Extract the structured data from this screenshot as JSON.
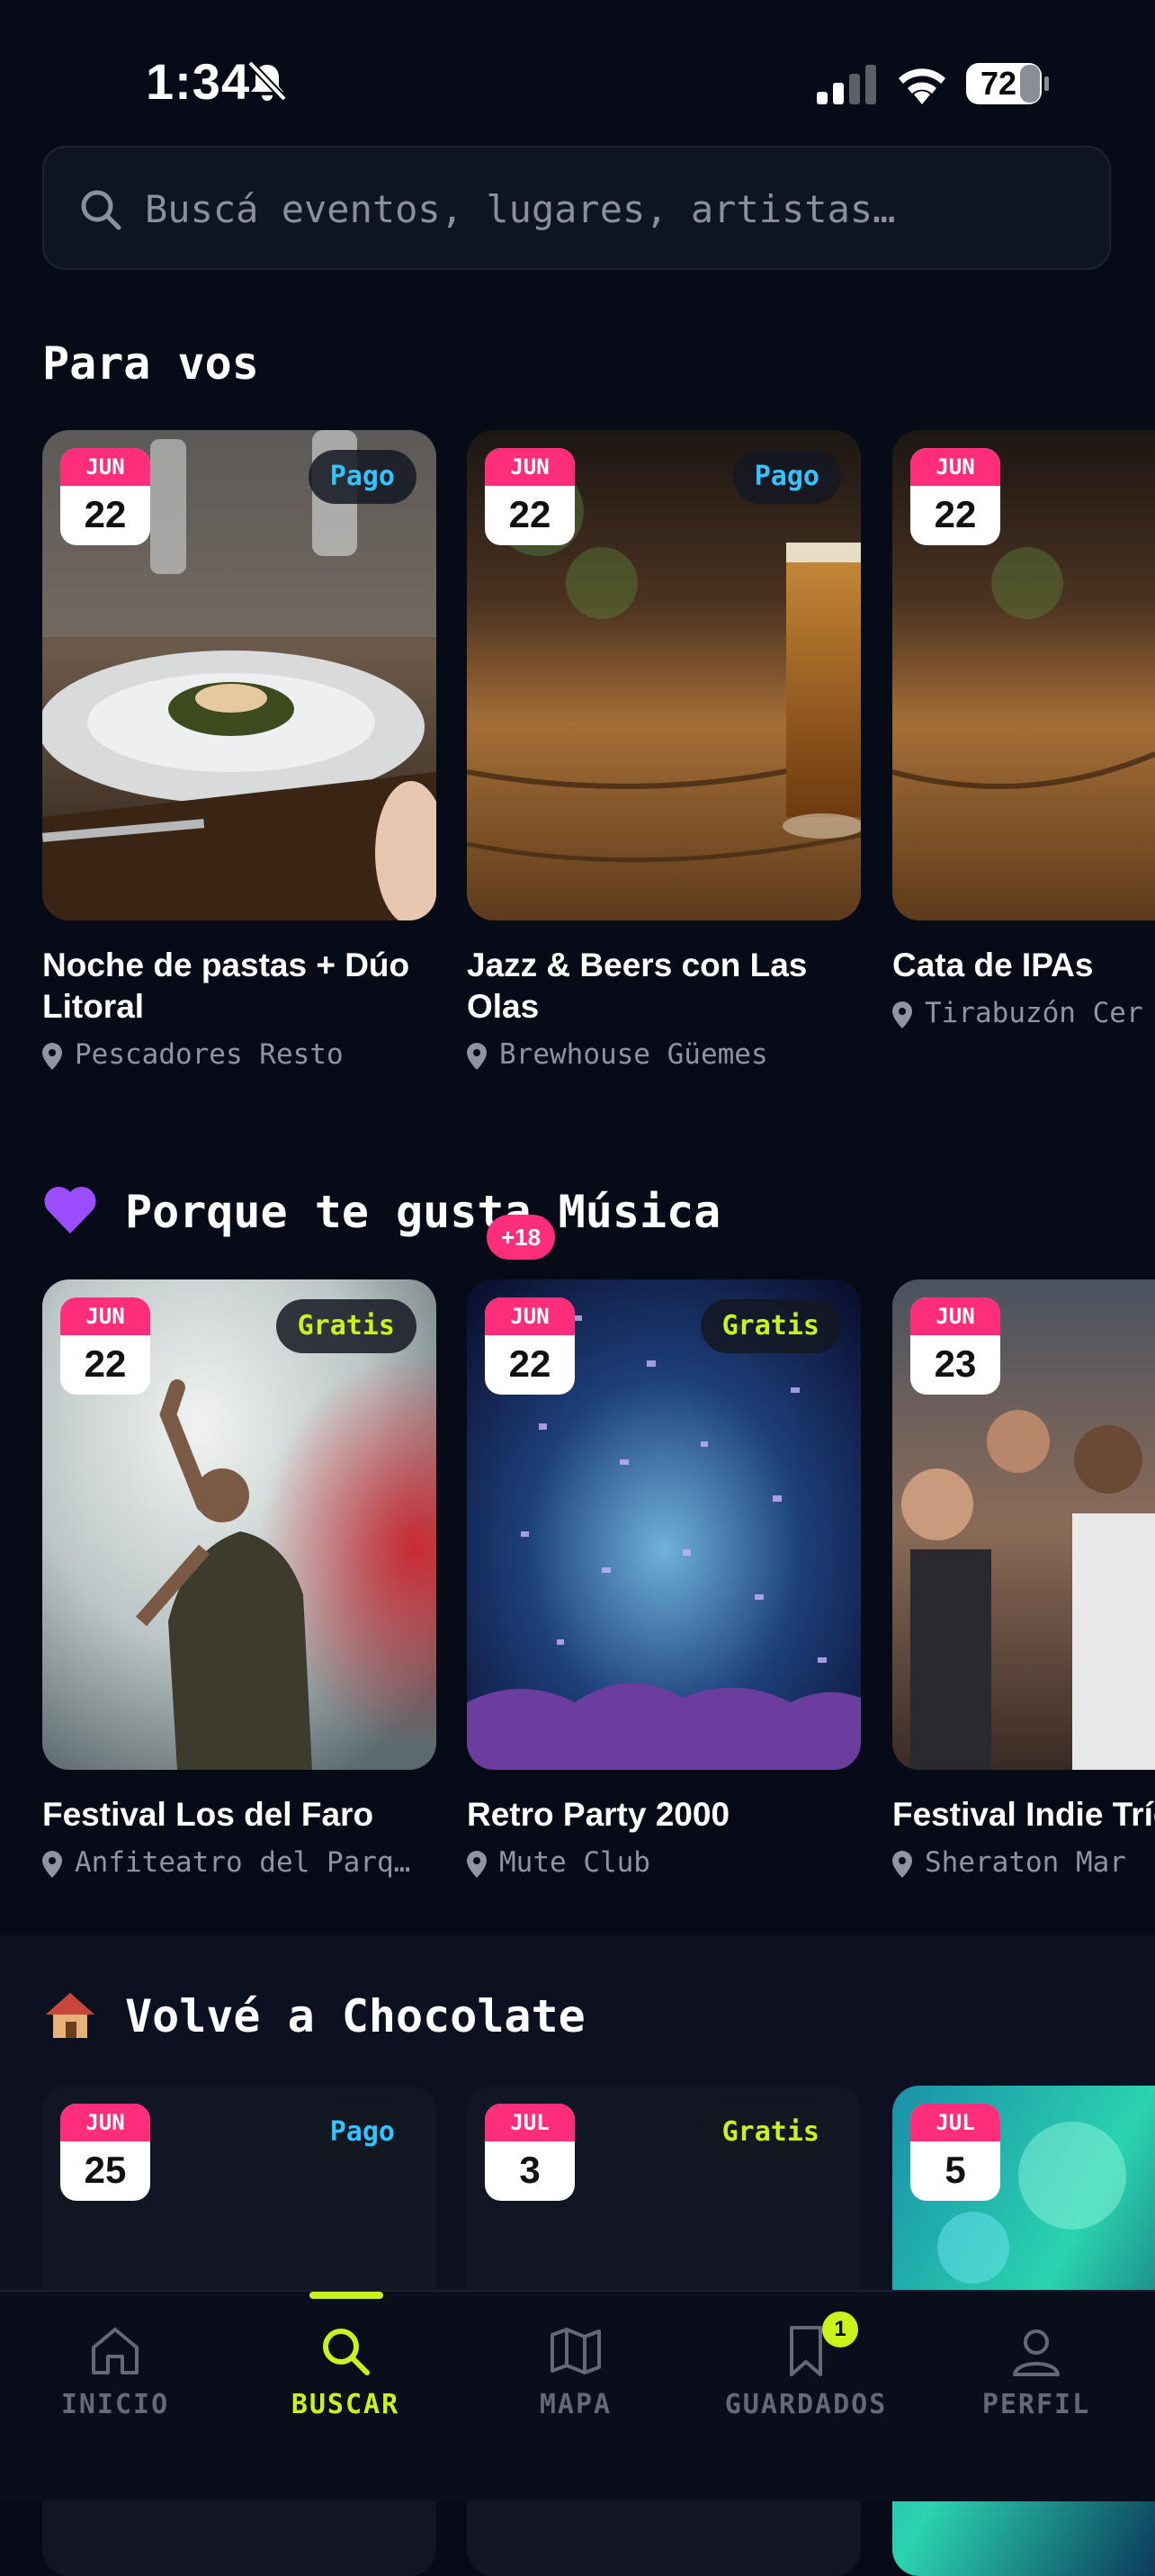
{
  "status_bar": {
    "time": "1:34",
    "battery": "72"
  },
  "search": {
    "placeholder": "Buscá eventos, lugares, artistas…"
  },
  "sections": [
    {
      "title": "Para vos",
      "cards": [
        {
          "month": "JUN",
          "day": "22",
          "price": "Pago",
          "title": "Noche de pastas + Dúo Litoral",
          "venue": "Pescadores Resto"
        },
        {
          "month": "JUN",
          "day": "22",
          "price": "Pago",
          "title": "Jazz & Beers con Las Olas",
          "venue": "Brewhouse Güemes"
        },
        {
          "month": "JUN",
          "day": "22",
          "price": "",
          "title": "Cata de IPAs",
          "venue": "Tirabuzón Cer"
        }
      ]
    },
    {
      "title": "Porque te gusta Música",
      "emoji": "purple-heart-icon",
      "cards": [
        {
          "month": "JUN",
          "day": "22",
          "price": "Gratis",
          "title": "Festival Los del Faro",
          "venue": "Anfiteatro del Parq…"
        },
        {
          "month": "JUN",
          "day": "22",
          "price": "Gratis",
          "age": "+18",
          "title": "Retro Party 2000",
          "venue": "Mute Club"
        },
        {
          "month": "JUN",
          "day": "23",
          "price": "",
          "title": "Festival Indie Trío",
          "venue": "Sheraton Mar"
        }
      ]
    },
    {
      "title": "Volvé a Chocolate",
      "emoji": "house-icon",
      "cards": [
        {
          "month": "JUN",
          "day": "25",
          "price": "Pago"
        },
        {
          "month": "JUL",
          "day": "3",
          "price": "Gratis"
        },
        {
          "month": "JUL",
          "day": "5",
          "price": ""
        }
      ]
    }
  ],
  "bottom_nav": [
    {
      "label": "INICIO",
      "icon": "home-icon"
    },
    {
      "label": "BUSCAR",
      "icon": "search-icon",
      "active": true
    },
    {
      "label": "MAPA",
      "icon": "map-icon"
    },
    {
      "label": "GUARDADOS",
      "icon": "bookmark-icon",
      "badge": "1"
    },
    {
      "label": "PERFIL",
      "icon": "user-icon"
    }
  ],
  "colors": {
    "accent": "#c8f31d",
    "date_month": "#ff2d7a",
    "pago": "#33c3ff",
    "gratis": "#c8f31d"
  }
}
